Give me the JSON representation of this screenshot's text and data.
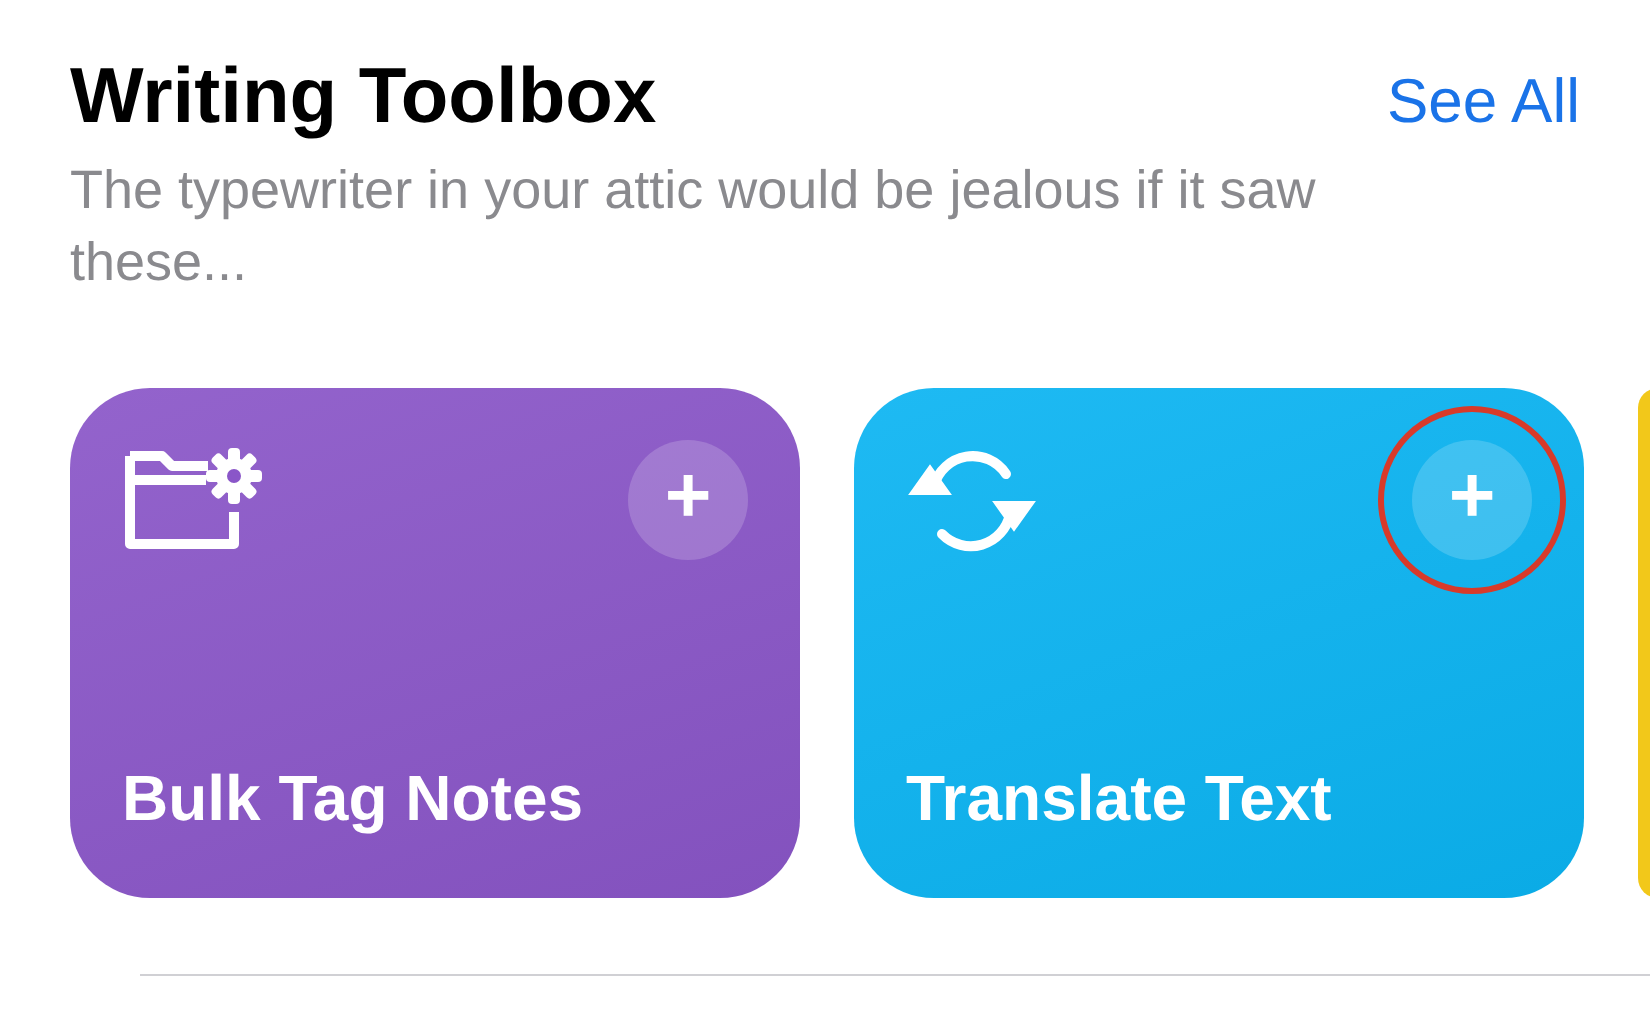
{
  "header": {
    "title": "Writing Toolbox",
    "link": "See All",
    "subtitle": "The typewriter in your attic would be jealous if it saw these..."
  },
  "cards": [
    {
      "kind": "folder",
      "title": "Bulk Tag Notes",
      "color": "#8a56c8",
      "add": "+",
      "highlighted": false
    },
    {
      "kind": "sync",
      "title": "Translate Text",
      "color": "#0bb4f2",
      "add": "+",
      "highlighted": true
    },
    {
      "kind": "partial",
      "color": "#f2c81a"
    }
  ]
}
